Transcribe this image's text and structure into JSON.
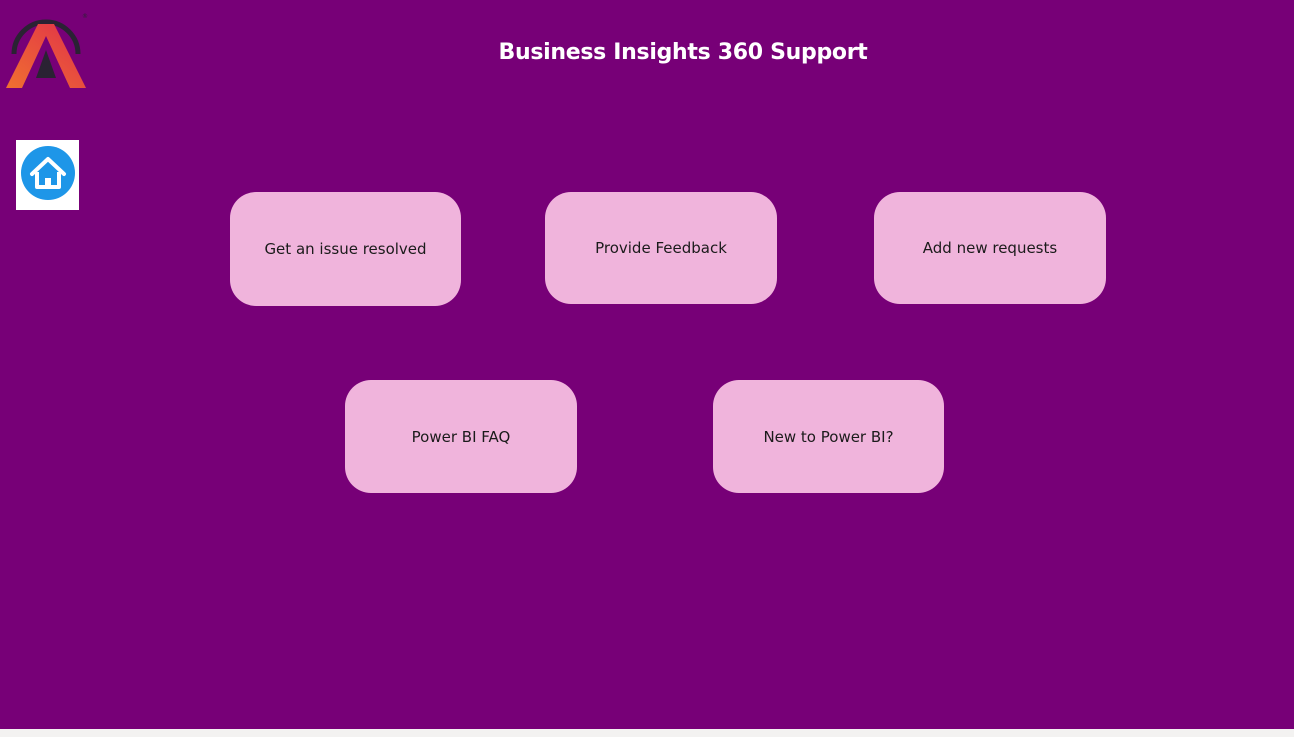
{
  "header": {
    "title": "Business Insights 360 Support"
  },
  "icons": {
    "logo": "brand-a-logo",
    "home": "home-icon"
  },
  "buttons": {
    "issue": "Get an issue resolved",
    "feedback": "Provide Feedback",
    "requests": "Add new requests",
    "faq": "Power BI FAQ",
    "new_to_powerbi": "New to Power BI?"
  },
  "colors": {
    "background": "#770077",
    "button_fill": "#f0b4dc",
    "title_text": "#ffffff",
    "home_icon": "#1e96e8",
    "logo_orange": "#f07030",
    "logo_red": "#e0304a",
    "logo_dark": "#2a2233"
  }
}
